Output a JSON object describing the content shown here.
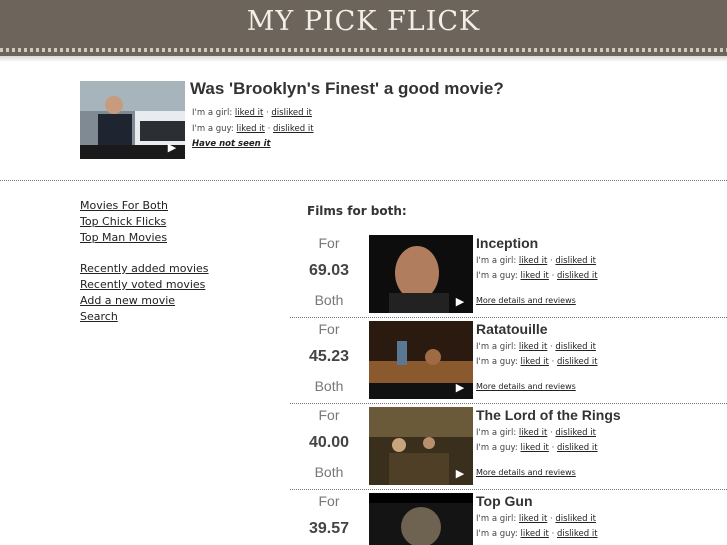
{
  "header": {
    "logo": "MY PICK FLICK"
  },
  "featured": {
    "title": "Was 'Brooklyn's Finest' a good movie?",
    "girl_prefix": "I'm a girl:",
    "guy_prefix": "I'm a guy:",
    "liked": "liked it",
    "disliked": "disliked it",
    "separator": "·",
    "not_seen": "Have not seen it"
  },
  "nav": {
    "group1": [
      "Movies For Both",
      "Top Chick Flicks",
      "Top Man Movies"
    ],
    "group2": [
      "Recently added movies",
      "Recently voted movies",
      "Add a new movie",
      "Search"
    ]
  },
  "section_title": "Films for both:",
  "score_top": "For",
  "score_bottom": "Both",
  "more_label": "More details and reviews",
  "movies": [
    {
      "title": "Inception",
      "score": "69.03"
    },
    {
      "title": "Ratatouille",
      "score": "45.23"
    },
    {
      "title": "The Lord of the Rings",
      "score": "40.00"
    },
    {
      "title": "Top Gun",
      "score": "39.57"
    }
  ],
  "icons": {
    "play": "play-icon"
  }
}
